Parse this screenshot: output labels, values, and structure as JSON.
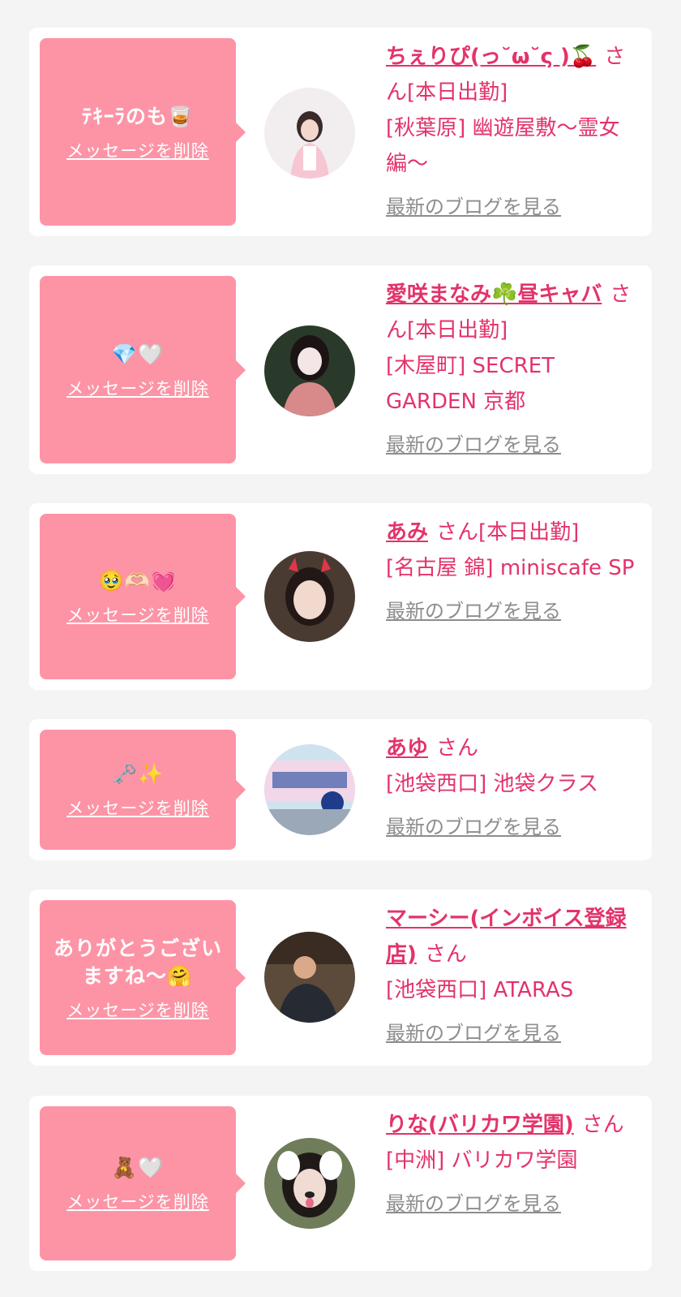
{
  "items": [
    {
      "message": "ﾃｷｰﾗのも🥃",
      "delete_label": "メッセージを削除",
      "name": "ちぇりぴ(っ˘ω˘ς )🍒",
      "san": "さん",
      "status": "[本日出勤]",
      "shop": "[秋葉原] 幽遊屋敷〜霊女編〜",
      "blog_label": "最新のブログを見る"
    },
    {
      "message": "💎🤍",
      "delete_label": "メッセージを削除",
      "name": "愛咲まなみ☘️昼キャバ",
      "san": "さん",
      "status": "[本日出勤]",
      "shop": "[木屋町] SECRET GARDEN 京都",
      "blog_label": "最新のブログを見る"
    },
    {
      "message": "🥹🫶🏻💓",
      "delete_label": "メッセージを削除",
      "name": "あみ",
      "san": "さん",
      "status": "[本日出勤]",
      "shop": "[名古屋 錦] miniscafe SP",
      "blog_label": "最新のブログを見る"
    },
    {
      "message": "🗝️✨",
      "delete_label": "メッセージを削除",
      "name": "あゆ",
      "san": "さん",
      "status": "",
      "shop": "[池袋西口] 池袋クラス",
      "blog_label": "最新のブログを見る"
    },
    {
      "message": "ありがとうございますね〜🤗",
      "delete_label": "メッセージを削除",
      "name": "マーシー(インボイス登録店)",
      "san": "さん",
      "status": "",
      "shop": "[池袋西口] ATARAS",
      "blog_label": "最新のブログを見る"
    },
    {
      "message": "🧸🤍",
      "delete_label": "メッセージを削除",
      "name": "りな(バリカワ学園)",
      "san": "さん",
      "status": "",
      "shop": "[中洲] バリカワ学園",
      "blog_label": "最新のブログを見る"
    }
  ]
}
